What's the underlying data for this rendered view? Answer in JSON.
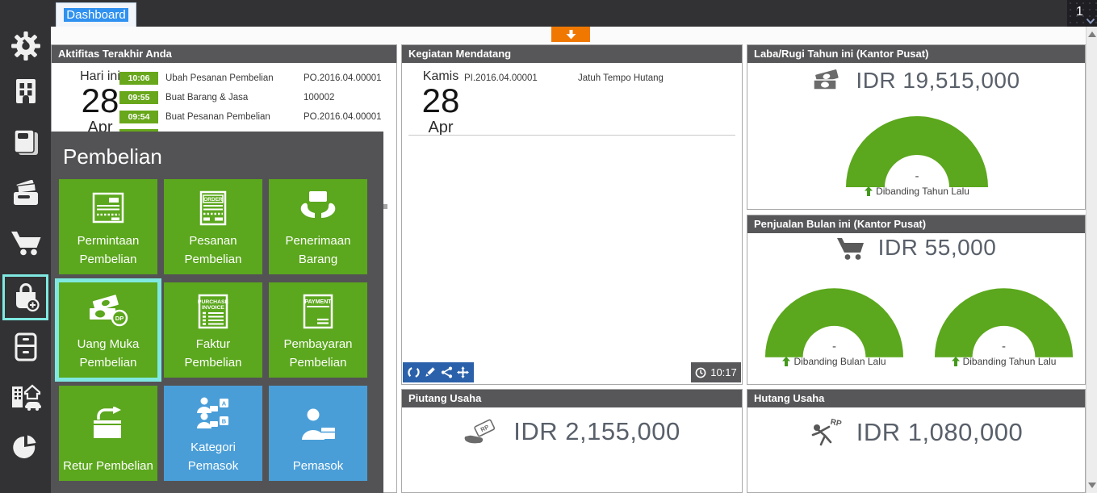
{
  "topbar": {
    "tab_label": "Dashboard",
    "notification_count": "1"
  },
  "sidebar": {
    "icons": [
      "settings",
      "company",
      "ledger-book",
      "cash-bank",
      "sales-cart",
      "purchase-bag",
      "inventory",
      "fixed-assets",
      "reports-pie"
    ],
    "active": "purchase-bag"
  },
  "quick_menu": {
    "title": "Pembelian",
    "tiles": [
      {
        "label": "Permintaan Pembelian",
        "icon": "request-document",
        "color": "green"
      },
      {
        "label": "Pesanan Pembelian",
        "icon": "order-document",
        "icon_text": "ORDER",
        "color": "green"
      },
      {
        "label": "Penerimaan Barang",
        "icon": "receive-goods",
        "color": "green"
      },
      {
        "label": "Uang Muka Pembelian",
        "icon": "down-payment-money",
        "icon_text": "DP",
        "color": "green",
        "highlighted": true
      },
      {
        "label": "Faktur Pembelian",
        "icon": "purchase-invoice-document",
        "icon_text_line1": "PURCHASE",
        "icon_text_line2": "INVOICE",
        "color": "green"
      },
      {
        "label": "Pembayaran Pembelian",
        "icon": "payment-document",
        "icon_text": "PAYMENT",
        "color": "green"
      },
      {
        "label": "Retur Pembelian",
        "icon": "purchase-return",
        "color": "green"
      },
      {
        "label": "Kategori Pemasok",
        "icon": "supplier-category",
        "icon_text_a": "A",
        "icon_text_b": "B",
        "color": "blue"
      },
      {
        "label": "Pemasok",
        "icon": "supplier-person",
        "color": "blue"
      }
    ]
  },
  "panels": {
    "aktifitas": {
      "title": "Aktifitas Terakhir Anda",
      "date_label": "Hari ini",
      "date_day": "28",
      "date_month": "Apr",
      "events": [
        {
          "time": "10:06",
          "action": "Ubah Pesanan Pembelian",
          "ref": "PO.2016.04.00001"
        },
        {
          "time": "09:55",
          "action": "Buat Barang & Jasa",
          "ref": "100002"
        },
        {
          "time": "09:54",
          "action": "Buat Pesanan Pembelian",
          "ref": "PO.2016.04.00001"
        }
      ]
    },
    "kegiatan": {
      "title": "Kegiatan Mendatang",
      "day_name": "Kamis",
      "date_day": "28",
      "date_month": "Apr",
      "events": [
        {
          "ref": "PI.2016.04.00001",
          "desc": "Jatuh Tempo Hutang"
        }
      ],
      "timestamp": "10:17"
    },
    "laba_rugi": {
      "title": "Laba/Rugi Tahun ini (Kantor Pusat)",
      "amount": "IDR 19,515,000",
      "gauge_value": "-",
      "gauge_label": "Dibanding Tahun Lalu"
    },
    "penjualan": {
      "title": "Penjualan Bulan ini (Kantor Pusat)",
      "amount": "IDR 55,000",
      "gauges": [
        {
          "value": "-",
          "label": "Dibanding Bulan Lalu"
        },
        {
          "value": "-",
          "label": "Dibanding Tahun Lalu"
        }
      ]
    },
    "piutang": {
      "title": "Piutang Usaha",
      "amount": "IDR 2,155,000",
      "icon_text": "RP"
    },
    "hutang": {
      "title": "Hutang Usaha",
      "amount": "IDR 1,080,000",
      "icon_text": "RP"
    }
  },
  "colors": {
    "accent_green": "#5ba71d",
    "accent_blue": "#4a9ed8",
    "badge_green": "#68a71b",
    "highlight_cyan": "#7fe9e1",
    "orange_button": "#f07800",
    "toolbar_blue": "#2b61aa",
    "header_gray": "#57575a",
    "overlay_gray": "#535355",
    "chrome_dark": "#323234"
  }
}
